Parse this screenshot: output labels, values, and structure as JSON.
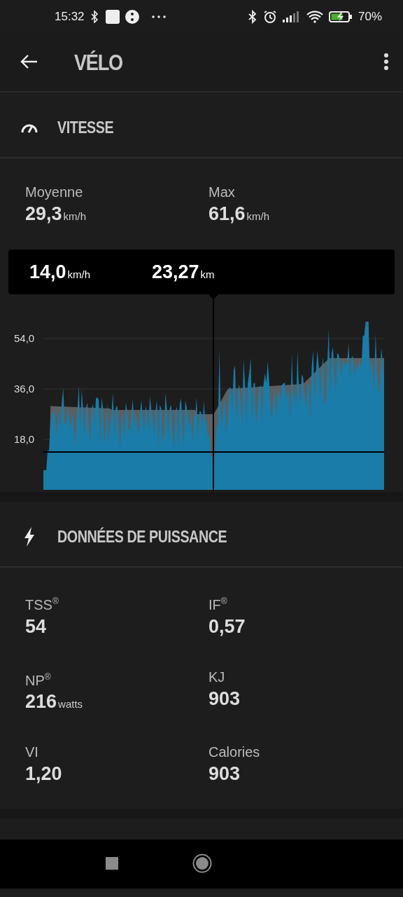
{
  "status_bar": {
    "time": "15:32",
    "battery": "70%"
  },
  "header": {
    "title": "VÉLO"
  },
  "speed": {
    "heading": "VITESSE",
    "stats": [
      {
        "label": "Moyenne",
        "value": "29,3",
        "unit": "km/h"
      },
      {
        "label": "Max",
        "value": "61,6",
        "unit": "km/h"
      }
    ],
    "tooltip": [
      {
        "value": "14,0",
        "unit": "km/h"
      },
      {
        "value": "23,27",
        "unit": "km"
      }
    ],
    "y_labels": [
      "54,0",
      "36,0",
      "18,0"
    ]
  },
  "power": {
    "heading": "DONNÉES DE PUISSANCE",
    "stats": [
      {
        "label": "TSS$^{®}$",
        "value": "54"
      },
      {
        "label": "IF$^{®}$",
        "value": "0,57"
      },
      {
        "label": "NP$^{®}$",
        "value": "216",
        "unit": "watts"
      },
      {
        "label": "KJ",
        "value": "903"
      },
      {
        "label": "VI",
        "value": "1,20"
      },
      {
        "label": "Calories",
        "value": "903"
      }
    ]
  }
}
